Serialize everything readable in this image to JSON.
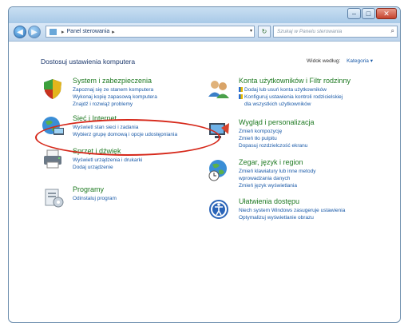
{
  "window": {
    "controls": {
      "minimize": "–",
      "maximize": "□",
      "close": "✕"
    }
  },
  "address": {
    "breadcrumb": [
      "Panel sterowania"
    ],
    "sep": "▸",
    "dropdown": "▾"
  },
  "search": {
    "placeholder": "Szukaj w Panelu sterowania",
    "icon": "⌕"
  },
  "main": {
    "heading": "Dostosuj ustawienia komputera",
    "view_by_label": "Widok według:",
    "view_by_value": "Kategoria ▾"
  },
  "categories": {
    "system": {
      "title": "System i zabezpieczenia",
      "links": [
        "Zapoznaj się ze stanem komputera",
        "Wykonaj kopię zapasową komputera",
        "Znajdź i rozwiąż problemy"
      ]
    },
    "network": {
      "title": "Sieć i Internet",
      "links": [
        "Wyświetl stan sieci i zadania",
        "Wybierz grupę domową i opcje udostępniania"
      ]
    },
    "hardware": {
      "title": "Sprzęt i dźwięk",
      "links": [
        "Wyświetl urządzenia i drukarki",
        "Dodaj urządzenie"
      ]
    },
    "programs": {
      "title": "Programy",
      "links": [
        "Odinstaluj program"
      ]
    },
    "accounts": {
      "title": "Konta użytkowników i Filtr rodzinny",
      "links": [
        "Dodaj lub usuń konta użytkowników",
        "Konfiguruj ustawienia kontroli rodzicielskiej",
        "dla wszystkich użytkowników"
      ]
    },
    "appearance": {
      "title": "Wygląd i personalizacja",
      "links": [
        "Zmień kompozycję",
        "Zmień tło pulpitu",
        "Dopasuj rozdzielczość ekranu"
      ]
    },
    "clock": {
      "title": "Zegar, język i region",
      "links": [
        "Zmień klawiatury lub inne metody",
        "wprowadzania danych",
        "Zmień język wyświetlania"
      ]
    },
    "access": {
      "title": "Ułatwienia dostępu",
      "links": [
        "Niech system Windows zasugeruje ustawienia",
        "Optymalizuj wyświetlanie obrazu"
      ]
    }
  }
}
